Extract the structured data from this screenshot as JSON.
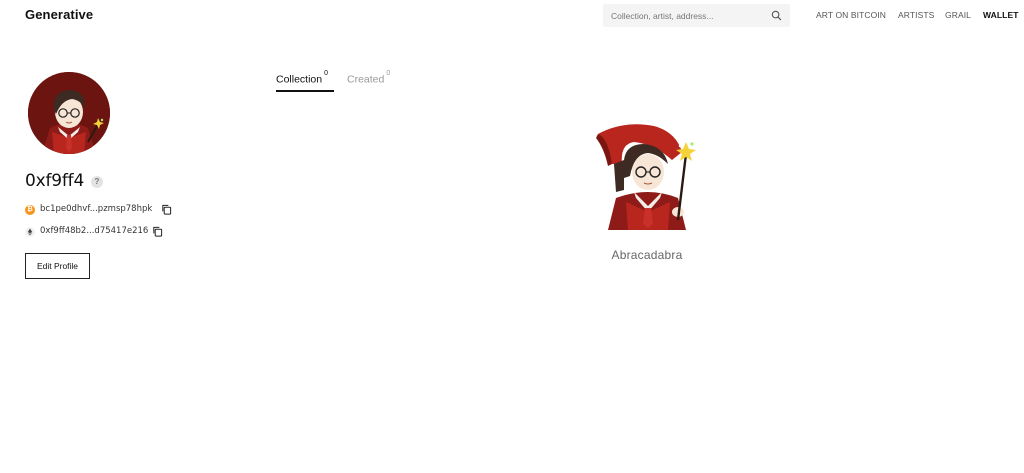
{
  "header": {
    "brand": "Generative",
    "search_placeholder": "Collection, artist, address...",
    "nav": [
      {
        "label": "ART ON BITCOIN",
        "active": false
      },
      {
        "label": "ARTISTS",
        "active": false
      },
      {
        "label": "GRAIL",
        "active": false
      },
      {
        "label": "WALLET",
        "active": true
      }
    ]
  },
  "profile": {
    "username": "0xf9ff4",
    "help": "?",
    "btc_address": "bc1pe0dhvf...pzmsp78hpk",
    "eth_address": "0xf9ff48b2...d75417e216",
    "edit_label": "Edit Profile"
  },
  "tabs": [
    {
      "label": "Collection",
      "count": "0",
      "active": true
    },
    {
      "label": "Created",
      "count": "0",
      "active": false
    }
  ],
  "items": [
    {
      "title": "Abracadabra"
    }
  ],
  "colors": {
    "accent": "#111111",
    "btc": "#f7931a",
    "avatar_bg": "#6b1410",
    "search_bg": "#f4f4f4"
  },
  "icons": [
    "search-icon",
    "question-icon",
    "bitcoin-icon",
    "ethereum-icon",
    "copy-icon"
  ]
}
